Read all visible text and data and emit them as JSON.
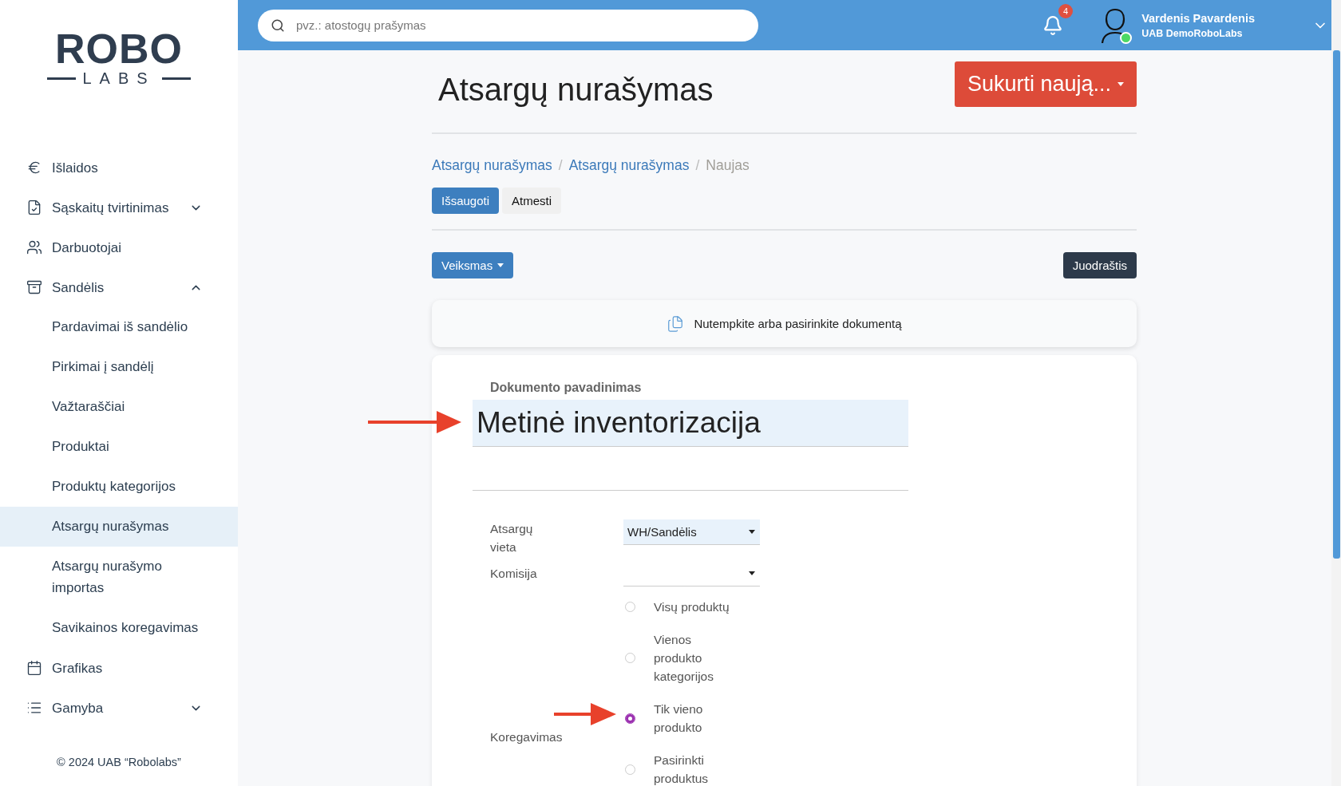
{
  "logo": {
    "word": "ROBO",
    "sub": "LABS"
  },
  "sidebar": {
    "items": [
      {
        "label": "Išlaidos",
        "selected": false
      },
      {
        "label": "Sąskaitų tvirtinimas",
        "expanded": false,
        "selected": false
      },
      {
        "label": "Darbuotojai",
        "selected": false
      },
      {
        "label": "Sandėlis",
        "expanded": true,
        "selected": false,
        "children": [
          {
            "label": "Pardavimai iš sandėlio",
            "selected": false
          },
          {
            "label": "Pirkimai į sandėlį",
            "selected": false
          },
          {
            "label": "Važtaraščiai",
            "selected": false
          },
          {
            "label": "Produktai",
            "selected": false
          },
          {
            "label": "Produktų kategorijos",
            "selected": false
          },
          {
            "label": "Atsargų nurašymas",
            "selected": true
          },
          {
            "label": "Atsargų nurašymo importas",
            "selected": false
          },
          {
            "label": "Savikainos koregavimas",
            "selected": false
          }
        ]
      },
      {
        "label": "Grafikas",
        "selected": false
      },
      {
        "label": "Gamyba",
        "expanded": false,
        "selected": false
      }
    ],
    "footer": "© 2024 UAB “Robolabs”"
  },
  "topbar": {
    "search": {
      "placeholder": "pvz.: atostogų prašymas"
    },
    "notifications": "4",
    "user": {
      "name": "Vardenis Pavardenis",
      "company": "UAB DemoRoboLabs",
      "online": true
    }
  },
  "page": {
    "title": "Atsargų nurašymas",
    "create_button": "Sukurti naują...",
    "breadcrumb_separator": "/",
    "breadcrumbs": [
      {
        "label": "Atsargų nurašymas",
        "link": true
      },
      {
        "label": "Atsargų nurašymas",
        "link": true
      },
      {
        "label": "Naujas",
        "link": false
      }
    ],
    "save_button": "Išsaugoti",
    "discard_button": "Atmesti",
    "action_button": "Veiksmas",
    "status_button": "Juodraštis",
    "dropzone": "Nutempkite arba pasirinkite dokumentą",
    "form": {
      "name_label": "Dokumento pavadinimas",
      "name_value": "Metinė inventorizacija",
      "location_label": "Atsargų vieta",
      "location_value": "WH/Sandėlis",
      "commission_label": "Komisija",
      "adjustment_label": "Koregavimas",
      "adjustment_options": [
        {
          "label": "Visų produktų",
          "selected": false
        },
        {
          "label": "Vienos produkto kategorijos",
          "selected": false
        },
        {
          "label": "Tik vieno produkto",
          "selected": true
        },
        {
          "label": "Pasirinkti produktus",
          "selected": false
        }
      ]
    }
  }
}
